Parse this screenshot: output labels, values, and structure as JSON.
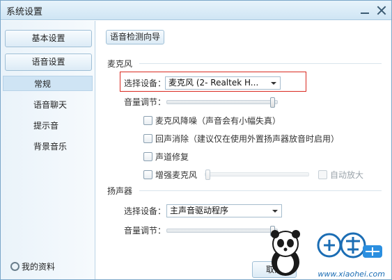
{
  "window": {
    "title": "系统设置"
  },
  "sidebar": {
    "buttons": [
      "基本设置",
      "语音设置"
    ],
    "items": [
      "常规",
      "语音聊天",
      "提示音",
      "背景音乐"
    ],
    "profile": "我的资料"
  },
  "content": {
    "wizard_button": "语音检测向导",
    "microphone": {
      "section": "麦克风",
      "device_label": "选择设备：",
      "device_value": "麦克风 (2- Realtek H...",
      "volume_label": "音量调节：",
      "volume_level": 0.98,
      "options": [
        {
          "label": "麦克风降噪（声音会有小幅失真）",
          "checked": false,
          "enabled": true
        },
        {
          "label": "回声消除（建议仅在使用外置扬声器放音时启用）",
          "checked": false,
          "enabled": true
        },
        {
          "label": "声道修复",
          "checked": false,
          "enabled": true
        },
        {
          "label": "增强麦克风",
          "checked": false,
          "enabled": true
        }
      ],
      "boost_level": 0.0,
      "auto_amplify": {
        "label": "自动放大",
        "checked": false,
        "enabled": false
      }
    },
    "speaker": {
      "section": "扬声器",
      "device_label": "选择设备：",
      "device_value": "主声音驱动程序",
      "volume_label": "音量调节：",
      "volume_level": 0.98
    },
    "cancel_button": "取消"
  },
  "watermark": {
    "site": "www.xiaohei.com"
  },
  "colors": {
    "highlight_border": "#d9281f",
    "sidebar_active": "#cfe4f4",
    "titlebar": "#cfe5f4"
  }
}
